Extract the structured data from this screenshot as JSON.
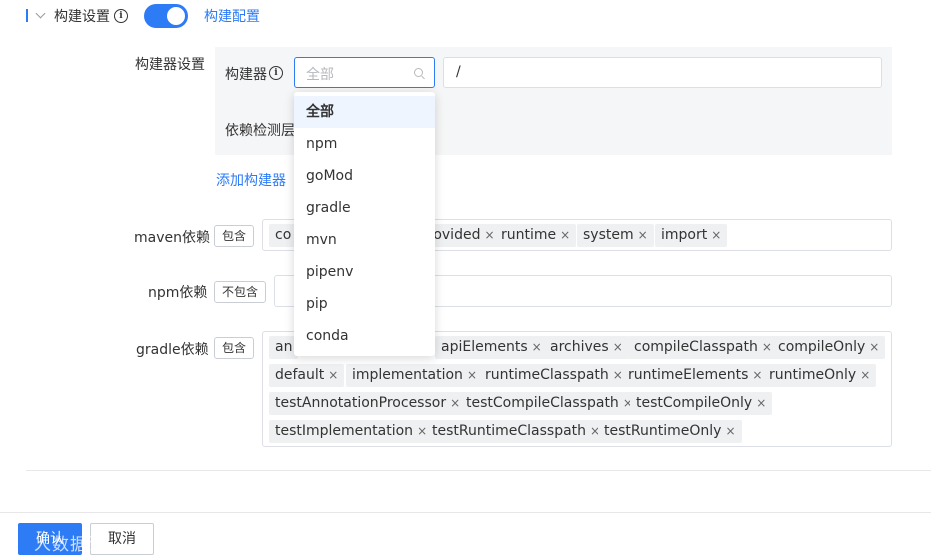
{
  "header": {
    "title": "构建设置",
    "toggle_on": true,
    "config_link": "构建配置"
  },
  "builder": {
    "section_label": "构建器设置",
    "field_label": "构建器",
    "select_placeholder": "全部",
    "path_value": "/",
    "detect_label": "依赖检测层",
    "add_link": "添加构建器"
  },
  "dropdown": {
    "options": [
      "全部",
      "npm",
      "goMod",
      "gradle",
      "mvn",
      "pipenv",
      "pip",
      "conda"
    ],
    "selected_index": 0
  },
  "maven": {
    "label": "maven依赖",
    "mode": "包含",
    "tags": [
      "co",
      "provided",
      "runtime",
      "system",
      "import"
    ]
  },
  "npm": {
    "label": "npm依赖",
    "mode": "不包含"
  },
  "gradle": {
    "label": "gradle依赖",
    "mode": "包含",
    "tags": [
      "an",
      "apiElements",
      "archives",
      "compileClasspath",
      "compileOnly",
      "default",
      "implementation",
      "runtimeClasspath",
      "runtimeElements",
      "runtimeOnly",
      "testAnnotationProcessor",
      "testCompileClasspath",
      "testCompileOnly",
      "testImplementation",
      "testRuntimeClasspath",
      "testRuntimeOnly"
    ]
  },
  "footer": {
    "confirm": "确认",
    "cancel": "取消"
  },
  "watermark": "人数据说",
  "tag_close_glyph": "×",
  "icons": [
    "chevron-down-icon",
    "info-icon",
    "search-icon",
    "close-icon"
  ],
  "colors": {
    "accent": "#2d7cf6",
    "panel_bg": "#f5f6f7",
    "tag_bg": "#eef0f2",
    "option_active_bg": "#eef5fe"
  }
}
